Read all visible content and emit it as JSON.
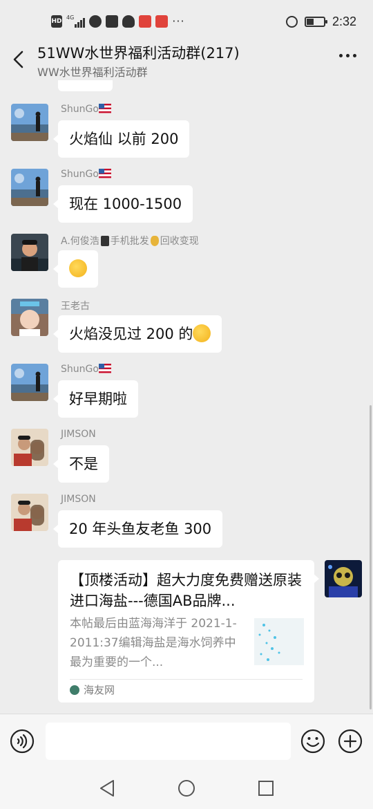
{
  "status_bar": {
    "time": "2:32",
    "hd_label": "HD",
    "network_label": "4G",
    "battery_level": 0.4,
    "more_dots": "···",
    "icons": [
      "hd-icon",
      "signal-icon",
      "app-icon",
      "app-icon",
      "qq-icon",
      "app-icon",
      "app-icon",
      "alarm-icon",
      "battery-icon"
    ]
  },
  "header": {
    "title": "51WW水世界福利活动群(217)",
    "subtitle": "WW水世界福利活动群"
  },
  "messages": [
    {
      "sender": "ShunGo",
      "text": "火焰仙 以前 200",
      "avatar": "landscape"
    },
    {
      "sender": "ShunGo",
      "text": "现在 1000-1500",
      "avatar": "landscape"
    },
    {
      "sender_part1": "A.何俊浩",
      "sender_part2": "手机批发",
      "sender_part3": "回收变现",
      "text": "",
      "emoji": "crying-laughing-emoji",
      "avatar": "man"
    },
    {
      "sender": "王老古",
      "text": "火焰没见过 200 的",
      "emoji": "crying-laughing-emoji",
      "avatar": "child"
    },
    {
      "sender": "ShunGo",
      "text": "好早期啦",
      "avatar": "landscape"
    },
    {
      "sender": "JIMSON",
      "text": "不是",
      "avatar": "couple"
    },
    {
      "sender": "JIMSON",
      "text": "20 年头鱼友老鱼 300",
      "avatar": "couple"
    }
  ],
  "link_card": {
    "title": "【顶楼活动】超大力度免费赠送原装进口海盐---德国AB品牌...",
    "description": "本帖最后由蓝海海洋于 2021-1-2011:37编辑海盐是海水饲养中最为重要的一个...",
    "source": "海友网"
  },
  "input": {
    "value": "",
    "placeholder": ""
  },
  "colors": {
    "background": "#ededed",
    "bubble": "#ffffff",
    "sender_name": "#8a8a8a",
    "link_source_icon": "#3f7d6a"
  }
}
